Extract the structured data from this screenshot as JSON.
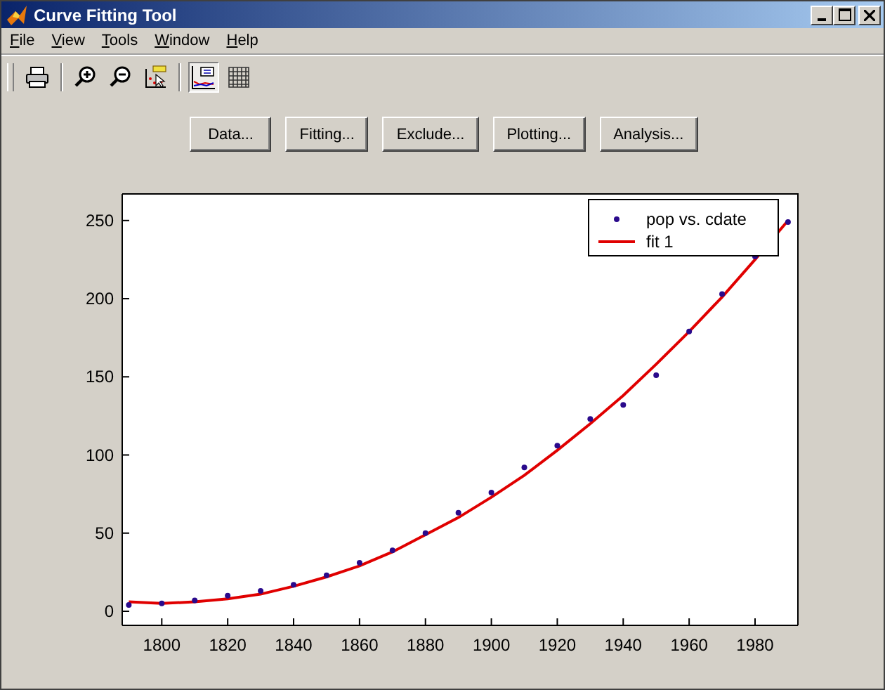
{
  "window": {
    "title": "Curve Fitting Tool"
  },
  "menu": [
    "File",
    "View",
    "Tools",
    "Window",
    "Help"
  ],
  "toolbar": {
    "legend_pressed": true,
    "grid_pressed": false
  },
  "buttons": [
    "Data...",
    "Fitting...",
    "Exclude...",
    "Plotting...",
    "Analysis..."
  ],
  "plot": {
    "chart_data": {
      "type": "line",
      "x": [
        1790,
        1800,
        1810,
        1820,
        1830,
        1840,
        1850,
        1860,
        1870,
        1880,
        1890,
        1900,
        1910,
        1920,
        1930,
        1940,
        1950,
        1960,
        1970,
        1980,
        1990
      ],
      "xlim": [
        1788,
        1993
      ],
      "ylim": [
        -9,
        267
      ],
      "xticks": [
        1800,
        1820,
        1840,
        1860,
        1880,
        1900,
        1920,
        1940,
        1960,
        1980
      ],
      "yticks": [
        0,
        50,
        100,
        150,
        200,
        250
      ],
      "legend": true,
      "series": [
        {
          "name": "pop vs. cdate",
          "color": "#2a0a8c",
          "type": "scatter",
          "values": [
            4,
            5,
            7,
            10,
            13,
            17,
            23,
            31,
            39,
            50,
            63,
            76,
            92,
            106,
            123,
            132,
            151,
            179,
            203,
            227,
            249
          ]
        },
        {
          "name": "fit 1",
          "color": "#e00000",
          "type": "line",
          "values": [
            6,
            5,
            6,
            8,
            11,
            16,
            22,
            29,
            38,
            49,
            60,
            73,
            87,
            103,
            120,
            138,
            158,
            179,
            201,
            225,
            250
          ]
        }
      ]
    }
  }
}
